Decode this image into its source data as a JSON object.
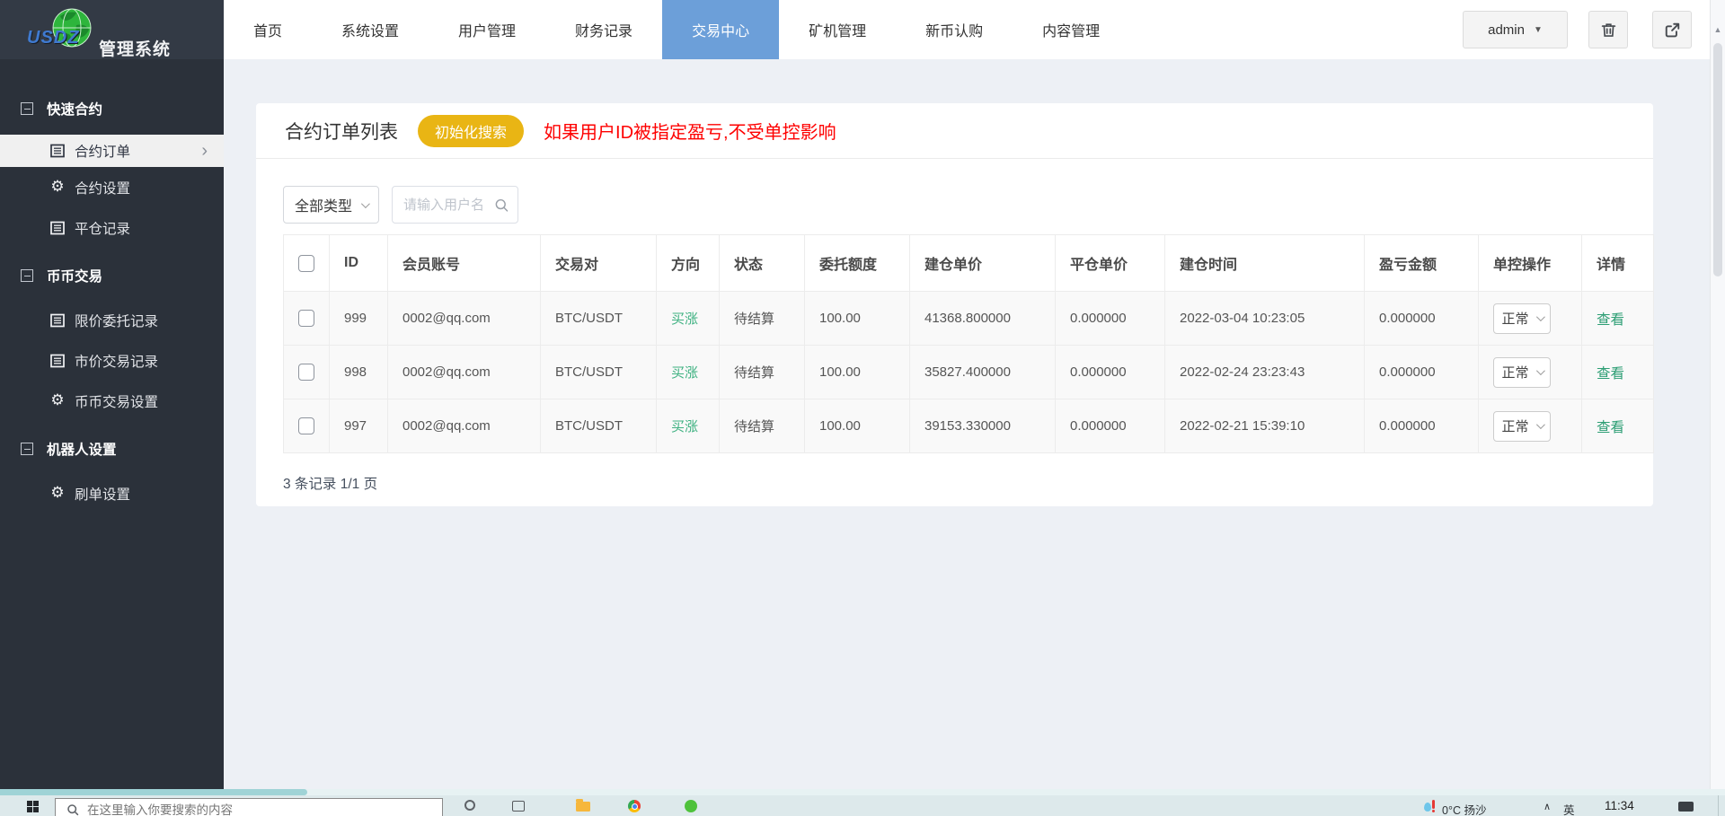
{
  "logo": {
    "brand": "USDZ",
    "title": "管理系统"
  },
  "topnav": {
    "items": [
      "首页",
      "系统设置",
      "用户管理",
      "财务记录",
      "交易中心",
      "矿机管理",
      "新币认购",
      "内容管理"
    ],
    "active": "交易中心"
  },
  "userbar": {
    "username": "admin"
  },
  "sidebar": {
    "sections": [
      {
        "label": "快速合约",
        "items": [
          {
            "label": "合约订单",
            "icon": "list-icon",
            "active": true
          },
          {
            "label": "合约设置",
            "icon": "gear-icon"
          },
          {
            "label": "平仓记录",
            "icon": "list-icon"
          }
        ]
      },
      {
        "label": "币币交易",
        "items": [
          {
            "label": "限价委托记录",
            "icon": "list-icon"
          },
          {
            "label": "市价交易记录",
            "icon": "list-icon"
          },
          {
            "label": "币币交易设置",
            "icon": "gear-icon"
          }
        ]
      },
      {
        "label": "机器人设置",
        "items": [
          {
            "label": "刷单设置",
            "icon": "gear-icon"
          }
        ]
      }
    ]
  },
  "content": {
    "card_title": "合约订单列表",
    "init_search_button": "初始化搜索",
    "warning": "如果用户ID被指定盈亏,不受单控影响",
    "type_filter_value": "全部类型",
    "username_placeholder": "请输入用户名",
    "table": {
      "headers": [
        "ID",
        "会员账号",
        "交易对",
        "方向",
        "状态",
        "委托额度",
        "建仓单价",
        "平仓单价",
        "建仓时间",
        "盈亏金额",
        "单控操作",
        "详情"
      ],
      "rows": [
        {
          "id": "999",
          "account": "0002@qq.com",
          "pair": "BTC/USDT",
          "direction": "买涨",
          "status": "待结算",
          "amount": "100.00",
          "open_price": "41368.800000",
          "close_price": "0.000000",
          "open_time": "2022-03-04 10:23:05",
          "pnl": "0.000000",
          "control": "正常",
          "detail": "查看"
        },
        {
          "id": "998",
          "account": "0002@qq.com",
          "pair": "BTC/USDT",
          "direction": "买涨",
          "status": "待结算",
          "amount": "100.00",
          "open_price": "35827.400000",
          "close_price": "0.000000",
          "open_time": "2022-02-24 23:23:43",
          "pnl": "0.000000",
          "control": "正常",
          "detail": "查看"
        },
        {
          "id": "997",
          "account": "0002@qq.com",
          "pair": "BTC/USDT",
          "direction": "买涨",
          "status": "待结算",
          "amount": "100.00",
          "open_price": "39153.330000",
          "close_price": "0.000000",
          "open_time": "2022-02-21 15:39:10",
          "pnl": "0.000000",
          "control": "正常",
          "detail": "查看"
        }
      ]
    },
    "pagination": "3 条记录 1/1 页"
  },
  "taskbar": {
    "search_placeholder": "在这里输入你要搜索的内容",
    "weather": "0°C 扬沙",
    "ime": "英",
    "time": "11:34"
  },
  "colors": {
    "accent_blue": "#6c9fd9",
    "button_yellow": "#e9b514",
    "warning_red": "#fe0000",
    "direction_green": "#3eb181",
    "link_green": "#2d9e74",
    "sidebar_bg": "#2b313a"
  },
  "glyphs": {
    "dropdown": "▼",
    "chevron_right": "›",
    "gear": "⚙",
    "up_arrow": "▲"
  }
}
